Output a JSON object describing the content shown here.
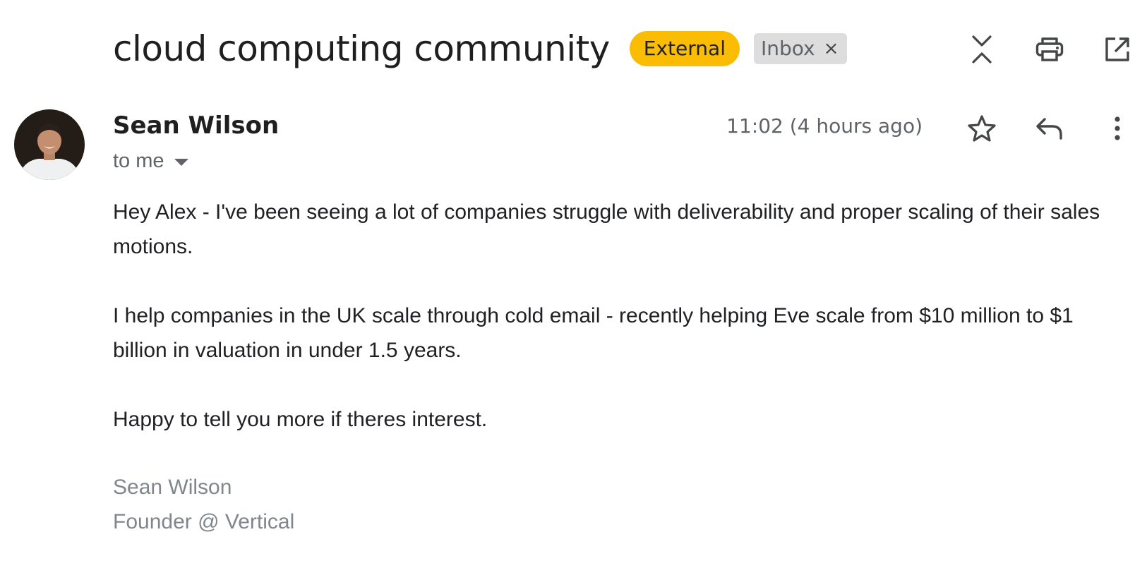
{
  "header": {
    "subject": "cloud computing community",
    "external_badge": "External",
    "inbox_label": "Inbox",
    "inbox_remove": "×"
  },
  "message": {
    "sender_name": "Sean Wilson",
    "recipient_label": "to me",
    "timestamp": "11:02 (4 hours ago)"
  },
  "body": {
    "paragraphs": [
      "Hey Alex - I've been seeing a lot of companies struggle with deliverability and proper scaling of their sales motions.",
      "I help companies in the UK scale through cold email - recently helping Eve scale from $10 million to $1 billion in valuation in under 1.5 years.",
      "Happy to tell you more if theres interest."
    ]
  },
  "signature": {
    "name": "Sean Wilson",
    "title": "Founder @ Vertical"
  },
  "icons": {
    "header": [
      "collapse-all-icon",
      "print-icon",
      "open-in-new-window-icon"
    ],
    "message": [
      "star-icon",
      "reply-icon",
      "more-options-icon"
    ]
  },
  "colors": {
    "external_badge": "#fbbc04",
    "inbox_badge": "#dddddd",
    "secondary_text": "#5f6368",
    "signature_text": "#80868b"
  }
}
